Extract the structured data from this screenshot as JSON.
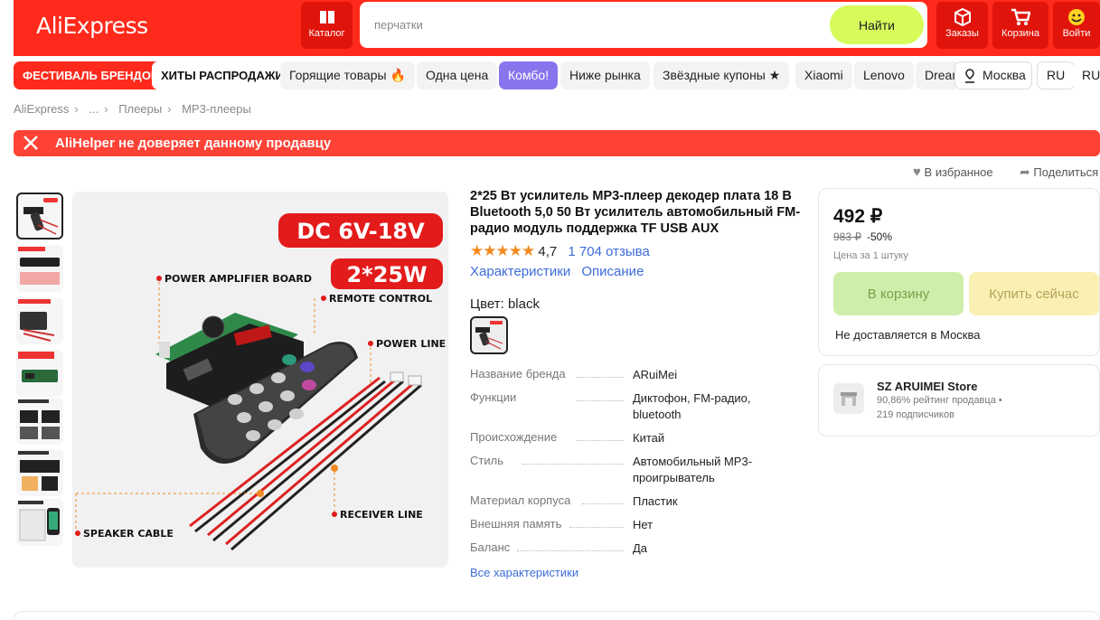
{
  "header": {
    "logo": "AliExpress",
    "catalog": "Каталог",
    "search_placeholder": "перчатки",
    "find": "Найти",
    "orders": "Заказы",
    "cart": "Корзина",
    "login": "Войти"
  },
  "nav": {
    "items": [
      "ФЕСТИВАЛЬ БРЕНДОВ",
      "ХИТЫ РАСПРОДАЖИ",
      "Горящие товары 🔥",
      "Одна цена",
      "Комбо!",
      "Ниже рынка",
      "Звёздные купоны ★",
      "Xiaomi",
      "Lenovo",
      "Dream"
    ],
    "location": "Москва",
    "lang": "RU",
    "currency": "RUB"
  },
  "breadcrumb": [
    "AliExpress",
    "...",
    "Плееры",
    "MP3-плееры"
  ],
  "warning": "AliHelper не доверяет данному продавцу",
  "actions": {
    "favorite": "В избранное",
    "share": "Поделиться"
  },
  "image_text": {
    "voltage": "DC 6V-18V",
    "power": "2*25W",
    "amp_board": "POWER AMPLIFIER BOARD",
    "remote": "REMOTE CONTROL",
    "power_line": "POWER LINE",
    "receiver": "RECEIVER LINE",
    "speaker": "SPEAKER CABLE"
  },
  "product": {
    "title": "2*25 Вт усилитель MP3-плеер декодер плата 18 В Bluetooth 5,0 50 Вт усилитель автомобильный FM-радио модуль поддержка TF USB AUX",
    "stars": "★★★★★",
    "rating": "4,7",
    "reviews": "1 704 отзыва",
    "tab_chars": "Характеристики",
    "tab_desc": "Описание",
    "color_label": "Цвет: black"
  },
  "specs": [
    {
      "k": "Название бренда",
      "v": "ARuiMei"
    },
    {
      "k": "Функции",
      "v": "Диктофон, FM-радио, bluetooth"
    },
    {
      "k": "Происхождение",
      "v": "Китай"
    },
    {
      "k": "Стиль",
      "v": "Автомобильный MP3-проигрыватель"
    },
    {
      "k": "Материал корпуса",
      "v": "Пластик"
    },
    {
      "k": "Внешняя память",
      "v": "Нет"
    },
    {
      "k": "Баланс",
      "v": "Да"
    }
  ],
  "all_chars": "Все характеристики",
  "buy": {
    "price": "492 ₽",
    "old_price": "983 ₽",
    "discount": "-50%",
    "per_unit": "Цена за 1 штуку",
    "to_cart": "В корзину",
    "buy_now": "Купить сейчас",
    "no_delivery": "Не доставляется в Москва"
  },
  "store": {
    "name": "SZ ARUIMEI Store",
    "rating": "90,86% рейтинг продавца •",
    "subs": "219 подписчиков"
  },
  "colors": {
    "brand": "#ff2a1b",
    "link": "#3d6cd9",
    "find": "#d6fb5b",
    "accent_purple": "#8a74ee"
  }
}
